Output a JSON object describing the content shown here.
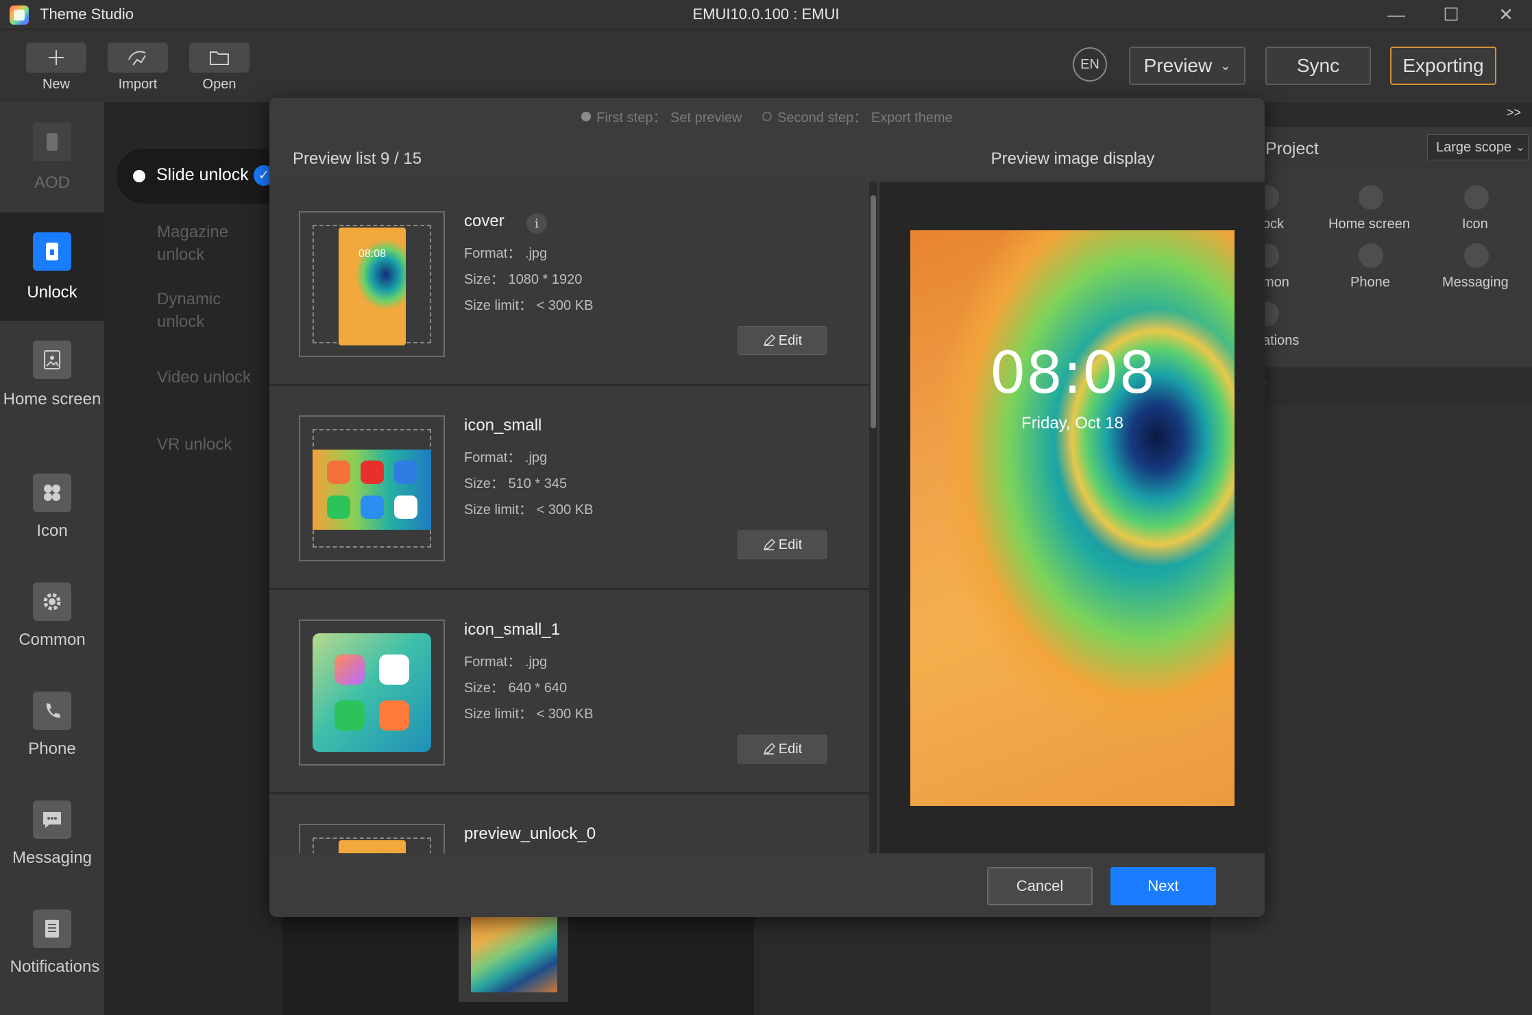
{
  "app": {
    "title": "Theme Studio",
    "window_title": "EMUI10.0.100 : EMUI"
  },
  "toolbar": {
    "new_label": "New",
    "import_label": "Import",
    "open_label": "Open",
    "lang_label": "EN",
    "preview_label": "Preview",
    "sync_label": "Sync",
    "export_label": "Exporting"
  },
  "sidebar": {
    "items": [
      {
        "label": "AOD",
        "icon": "phone-icon"
      },
      {
        "label": "Unlock",
        "icon": "lock-icon"
      },
      {
        "label": "Home screen",
        "icon": "home-screen-icon"
      },
      {
        "label": "Icon",
        "icon": "icon-grid-icon"
      },
      {
        "label": "Common",
        "icon": "gear-icon"
      },
      {
        "label": "Phone",
        "icon": "phone-call-icon"
      },
      {
        "label": "Messaging",
        "icon": "message-icon"
      },
      {
        "label": "Notifications",
        "icon": "notifications-icon"
      }
    ]
  },
  "subnav": {
    "items": [
      "Slide unlock",
      "Magazine unlock",
      "Dynamic unlock",
      "Video unlock",
      "VR unlock"
    ]
  },
  "right_panel": {
    "toggle": ">>",
    "project_label": "Project",
    "scope_label": "Large scope",
    "items": [
      "ock",
      "Home screen",
      "Icon",
      "mon",
      "Phone",
      "Messaging",
      "ations"
    ],
    "row2_label": "y"
  },
  "modal": {
    "step1": "First step： Set preview",
    "step2": "Second step： Export theme",
    "preview_list_title": "Preview list 9 / 15",
    "preview_display_title": "Preview image display",
    "cards": [
      {
        "name": "cover",
        "format": "Format： .jpg",
        "size": "Size： 1080 * 1920",
        "limit": "Size limit：  < 300 KB",
        "edit": "Edit",
        "mini_time": "08:08"
      },
      {
        "name": "icon_small",
        "format": "Format： .jpg",
        "size": "Size： 510 * 345",
        "limit": "Size limit：  < 300 KB",
        "edit": "Edit"
      },
      {
        "name": "icon_small_1",
        "format": "Format： .jpg",
        "size": "Size： 640 * 640",
        "limit": "Size limit：  < 300 KB",
        "edit": "Edit"
      },
      {
        "name": "preview_unlock_0"
      }
    ],
    "info_glyph": "i",
    "preview": {
      "time": "08:08",
      "date": "Friday, Oct 18"
    },
    "cancel_label": "Cancel",
    "next_label": "Next"
  },
  "colors": {
    "accent": "#1a7cff",
    "export_border": "#d9913a",
    "check": "#1a7cff"
  }
}
